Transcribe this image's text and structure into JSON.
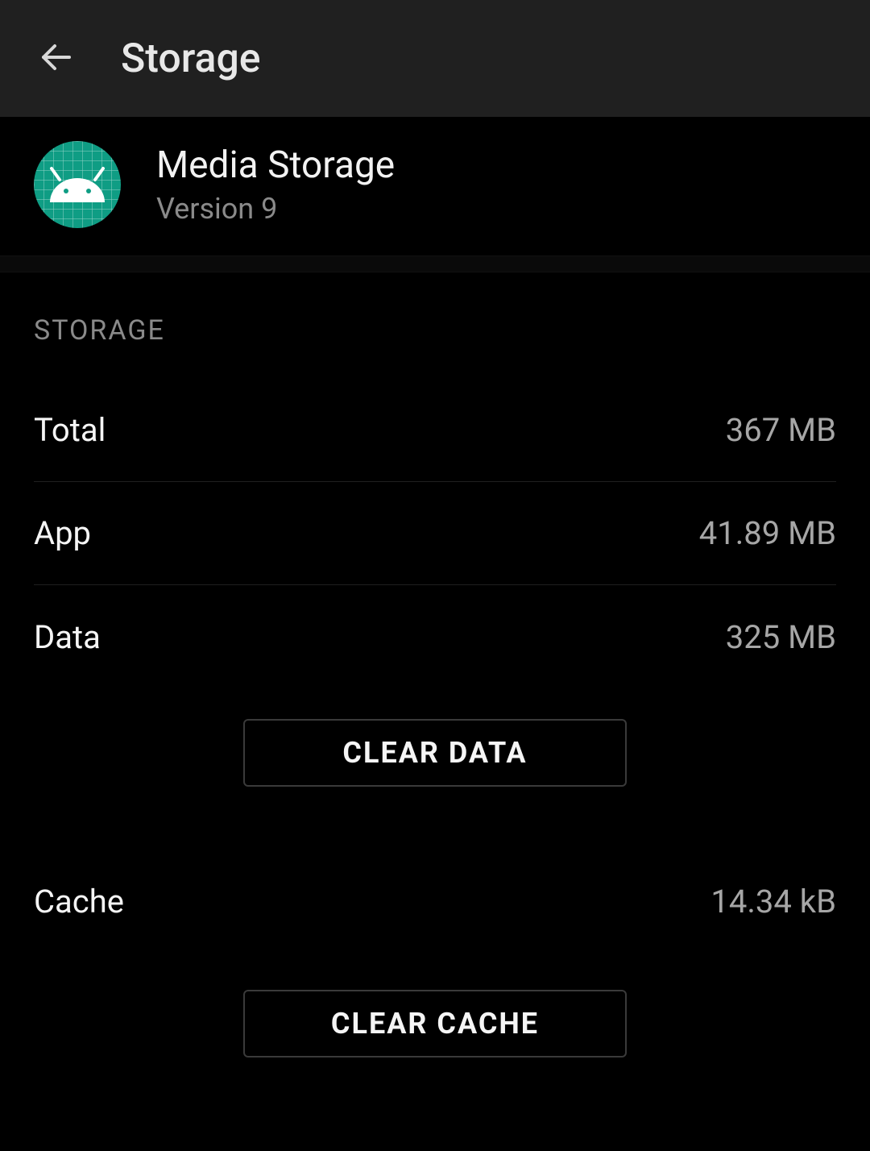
{
  "header": {
    "title": "Storage"
  },
  "app": {
    "name": "Media Storage",
    "version": "Version 9"
  },
  "section_label": "STORAGE",
  "rows": {
    "total": {
      "label": "Total",
      "value": "367 MB"
    },
    "app": {
      "label": "App",
      "value": "41.89 MB"
    },
    "data": {
      "label": "Data",
      "value": "325 MB"
    },
    "cache": {
      "label": "Cache",
      "value": "14.34 kB"
    }
  },
  "buttons": {
    "clear_data": "CLEAR DATA",
    "clear_cache": "CLEAR CACHE"
  },
  "colors": {
    "icon_bg": "#0f9d84"
  }
}
